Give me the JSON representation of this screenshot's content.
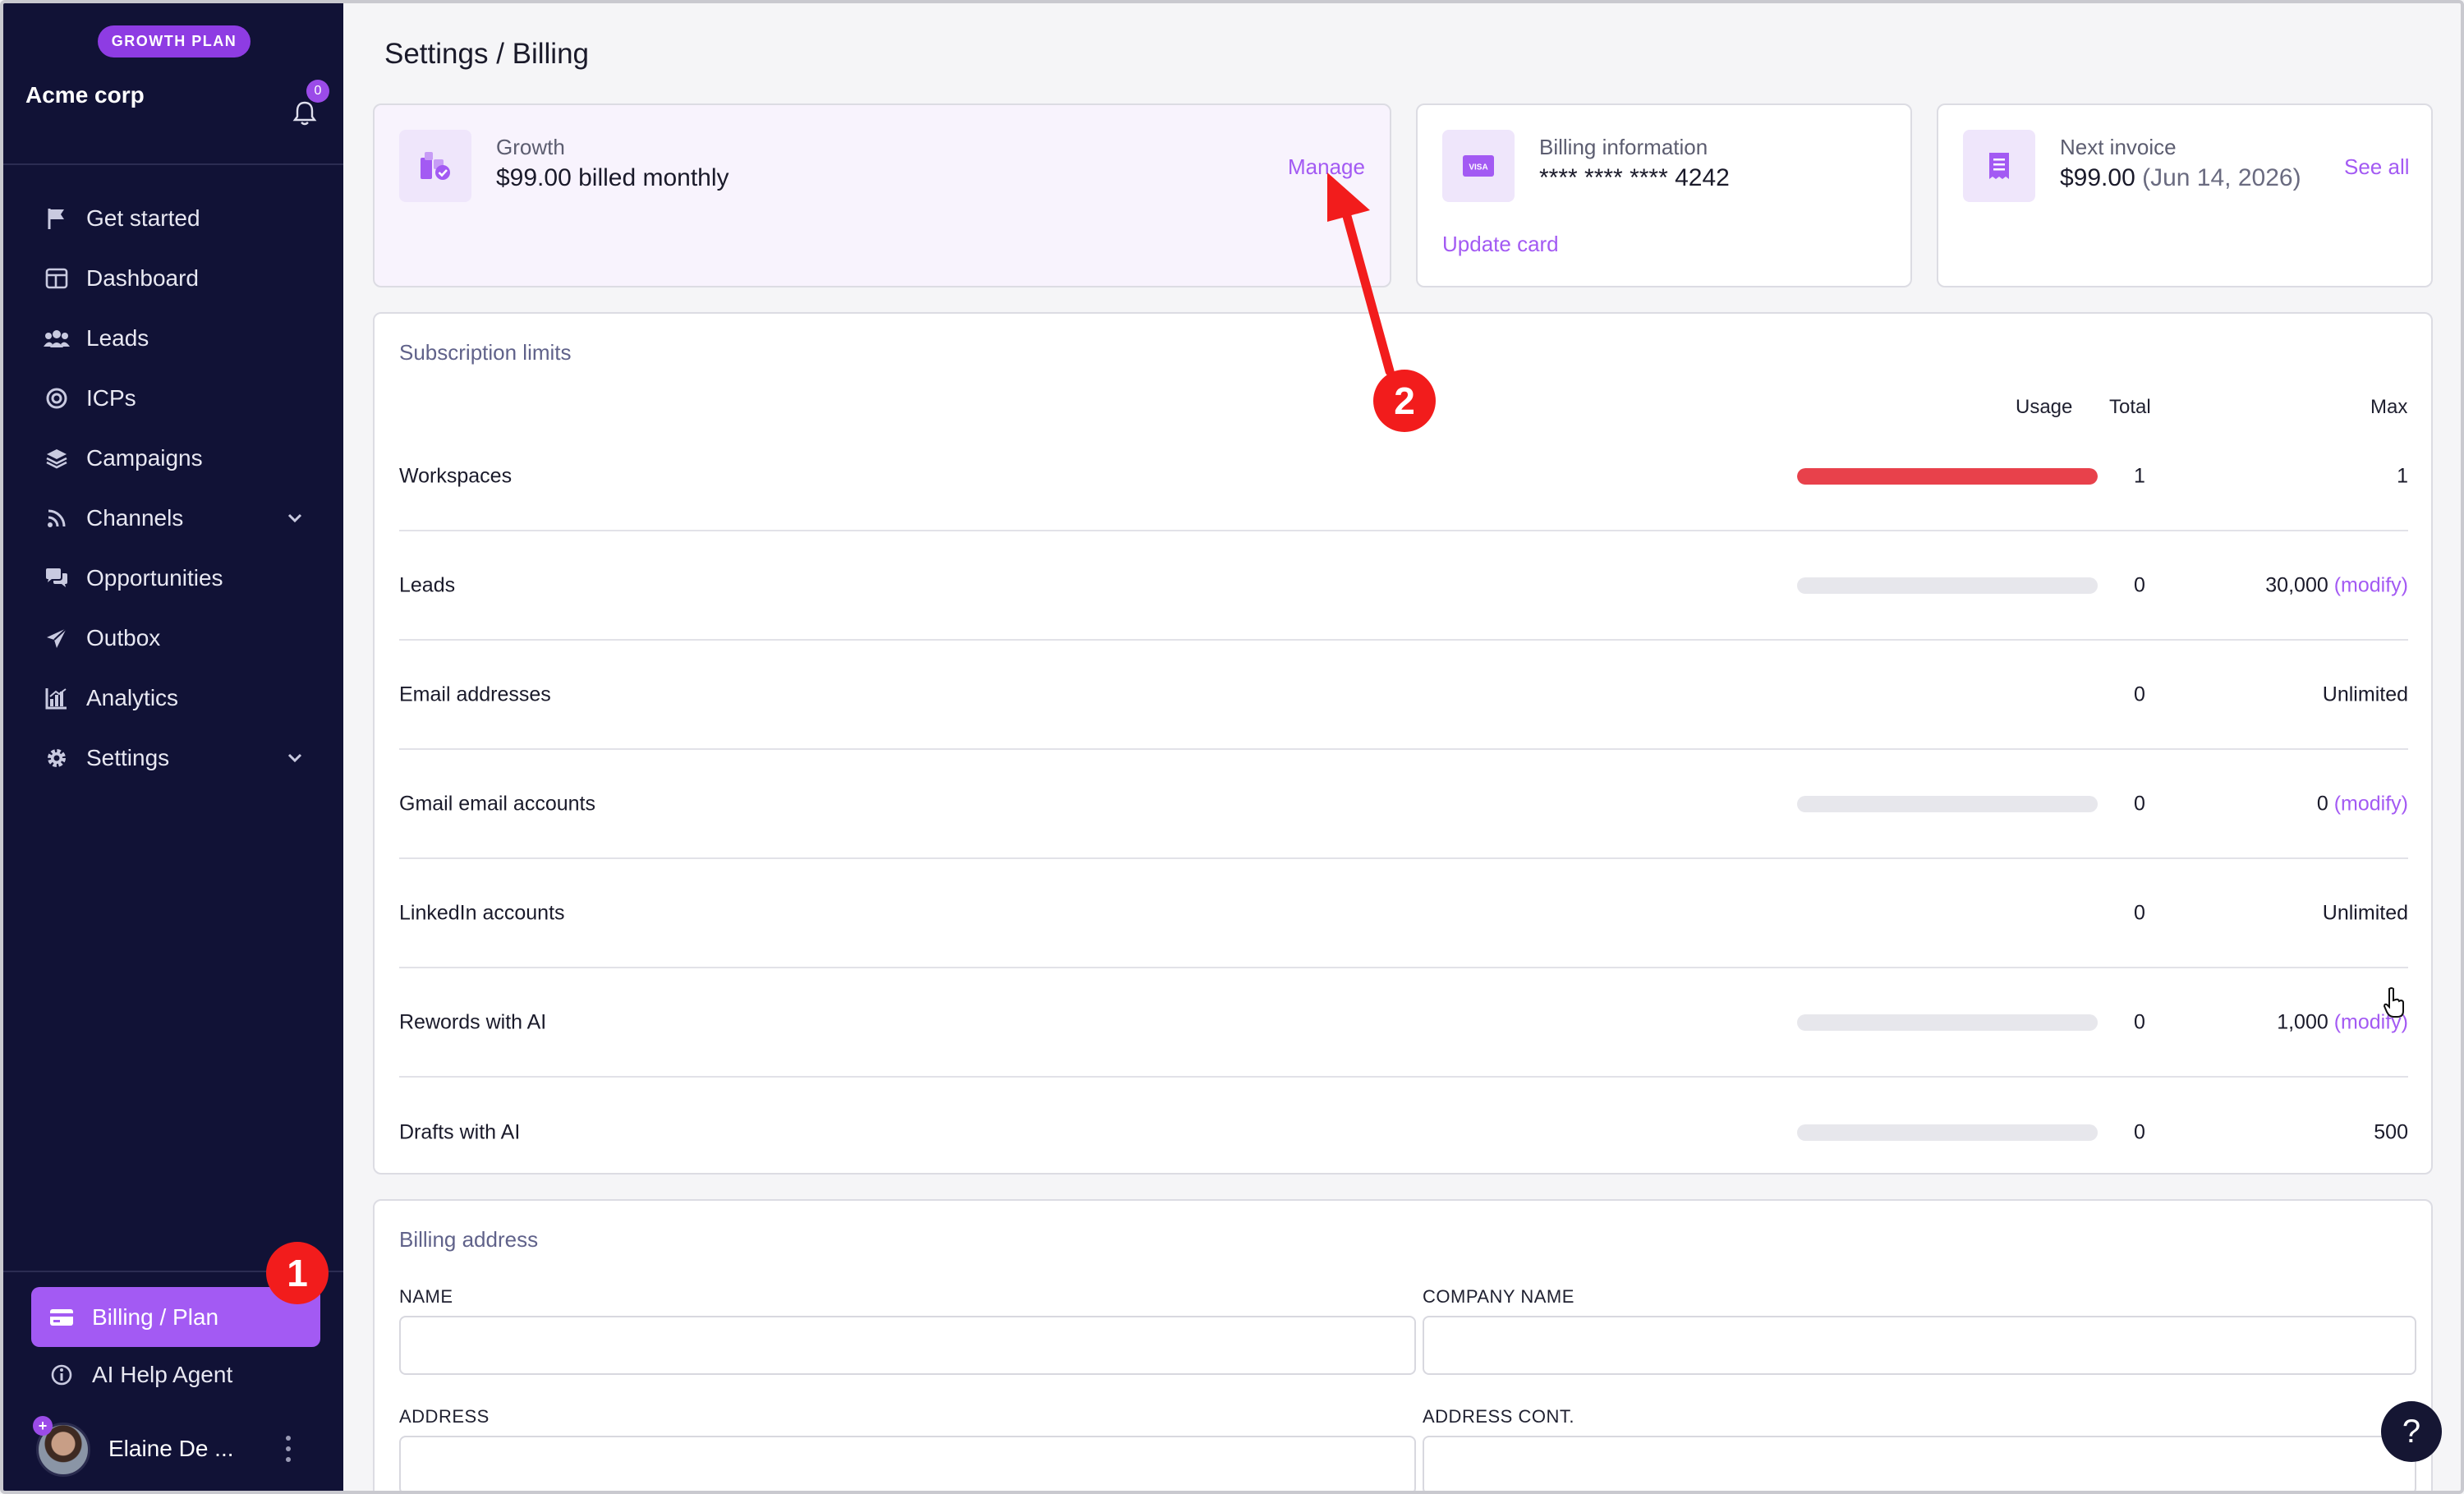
{
  "sidebar": {
    "plan_badge": "GROWTH PLAN",
    "org_name": "Acme corp",
    "notification_count": "0",
    "nav": [
      {
        "label": "Get started",
        "icon": "flag-icon"
      },
      {
        "label": "Dashboard",
        "icon": "dashboard-icon"
      },
      {
        "label": "Leads",
        "icon": "users-icon"
      },
      {
        "label": "ICPs",
        "icon": "target-icon"
      },
      {
        "label": "Campaigns",
        "icon": "layers-icon"
      },
      {
        "label": "Channels",
        "icon": "rss-icon",
        "expandable": true
      },
      {
        "label": "Opportunities",
        "icon": "chat-icon"
      },
      {
        "label": "Outbox",
        "icon": "paper-plane-icon"
      },
      {
        "label": "Analytics",
        "icon": "bar-chart-icon"
      },
      {
        "label": "Settings",
        "icon": "gear-icon",
        "expandable": true
      }
    ],
    "billing_label": "Billing / Plan",
    "help_label": "AI Help Agent",
    "user_name": "Elaine De ..."
  },
  "page": {
    "title": "Settings / Billing"
  },
  "plan_card": {
    "kicker": "Growth",
    "value": "$99.00 billed monthly",
    "link": "Manage"
  },
  "billing_card": {
    "kicker": "Billing information",
    "value": "**** **** **** 4242",
    "link": "Update card",
    "card_brand": "VISA"
  },
  "invoice_card": {
    "kicker": "Next invoice",
    "amount": "$99.00",
    "date": "(Jun 14, 2026)",
    "link": "See all"
  },
  "limits": {
    "title": "Subscription limits",
    "headers": {
      "usage": "Usage",
      "total": "Total",
      "max": "Max"
    },
    "rows": [
      {
        "label": "Workspaces",
        "usage": 1.0,
        "total": "1",
        "max": "1",
        "modify": ""
      },
      {
        "label": "Leads",
        "usage": 0,
        "total": "0",
        "max": "30,000",
        "modify": "(modify)"
      },
      {
        "label": "Email addresses",
        "usage": null,
        "total": "0",
        "max": "Unlimited",
        "modify": ""
      },
      {
        "label": "Gmail email accounts",
        "usage": 0,
        "total": "0",
        "max": "0",
        "modify": "(modify)"
      },
      {
        "label": "LinkedIn accounts",
        "usage": null,
        "total": "0",
        "max": "Unlimited",
        "modify": ""
      },
      {
        "label": "Rewords with AI",
        "usage": 0,
        "total": "0",
        "max": "1,000",
        "modify": "(modify)"
      },
      {
        "label": "Drafts with AI",
        "usage": 0,
        "total": "0",
        "max": "500",
        "modify": ""
      }
    ]
  },
  "address": {
    "title": "Billing address",
    "name_label": "NAME",
    "company_label": "COMPANY NAME",
    "address_label": "ADDRESS",
    "address_cont_label": "ADDRESS CONT."
  },
  "help_fab": "?",
  "annotations": {
    "marker_1": "1",
    "marker_2": "2"
  },
  "colors": {
    "accent": "#a35af3",
    "sidebar_bg": "#111236",
    "usage_full": "#e8414b",
    "annotation": "#f21c1c"
  }
}
